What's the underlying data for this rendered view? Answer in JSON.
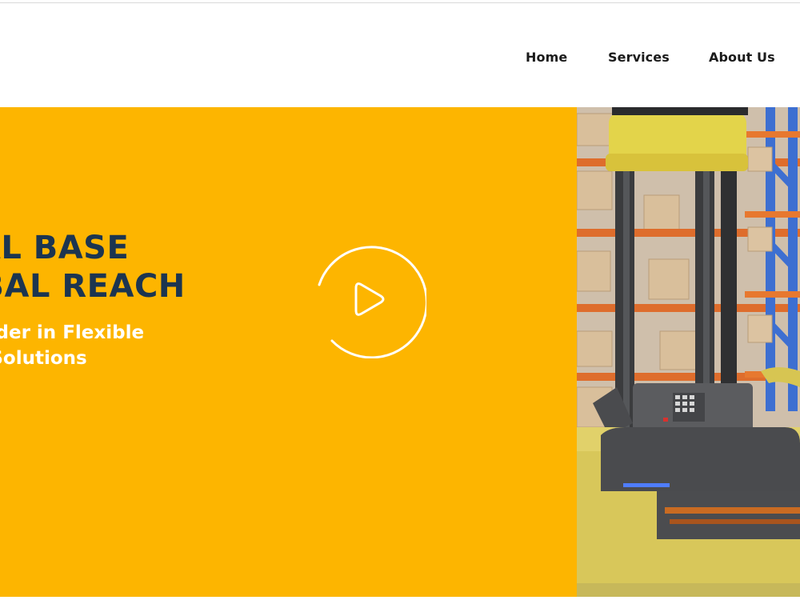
{
  "nav": {
    "items": [
      {
        "label": "Home"
      },
      {
        "label": "Services"
      },
      {
        "label": "About Us"
      }
    ]
  },
  "hero": {
    "headline_line1": "CAL BASE",
    "headline_line2": "OBAL REACH",
    "subhead_line1": "'s Leader in Flexible",
    "subhead_line2": "nent Solutions",
    "play_icon": "play-icon",
    "image_icon": "warehouse-robot-photo"
  },
  "colors": {
    "hero_yellow": "#fdb500",
    "headline": "#1c3550",
    "subhead": "#ffffff",
    "nav_text": "#1b1b1b"
  }
}
